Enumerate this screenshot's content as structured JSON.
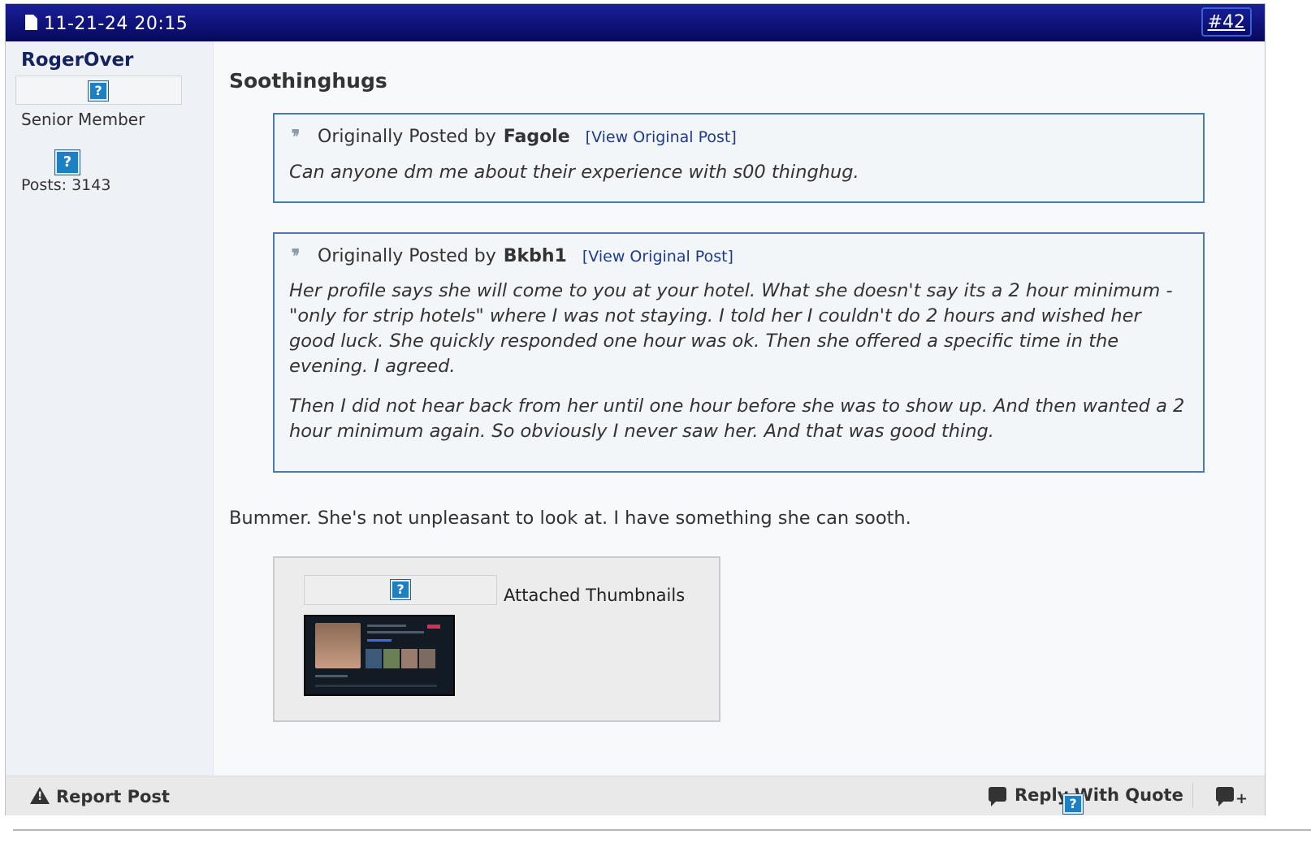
{
  "header": {
    "date": "11-21-24 20:15",
    "post_number": "#42"
  },
  "user": {
    "name": "RogerOver",
    "title": "Senior Member",
    "posts": "Posts: 3143",
    "broken_image_glyph": "?"
  },
  "post": {
    "title": "Soothinghugs",
    "quotes": [
      {
        "prefix": "Originally Posted by",
        "author": "Fagole",
        "view_link": "[View Original Post]",
        "paragraphs": [
          "Can anyone dm me about their experience with s00 thinghug."
        ]
      },
      {
        "prefix": "Originally Posted by",
        "author": "Bkbh1",
        "view_link": "[View Original Post]",
        "paragraphs": [
          "Her profile says she will come to you at your hotel. What she doesn't say its a 2 hour minimum - \"only for strip hotels\" where I was not staying. I told her I couldn't do 2 hours and wished her good luck. She quickly responded one hour was ok. Then she offered a specific time in the evening. I agreed.",
          "Then I did not hear back from her until one hour before she was to show up. And then wanted a 2 hour minimum again. So obviously I never saw her. And that was good thing."
        ]
      }
    ],
    "message": "Bummer. She's not unpleasant to look at. I have something she can sooth.",
    "attachments_title": "Attached Thumbnails"
  },
  "footer": {
    "report": "Report Post",
    "reply_with_quote": "Reply With Quote"
  },
  "colors": {
    "header_bg": "#0b1080",
    "username": "#14225f",
    "quote_border": "#4a7ab4",
    "link": "#1e3a8c"
  },
  "icons": [
    "document-icon",
    "broken-image-icon",
    "quote-marks-icon",
    "warning-icon",
    "reply-quote-icon",
    "multi-quote-icon"
  ]
}
